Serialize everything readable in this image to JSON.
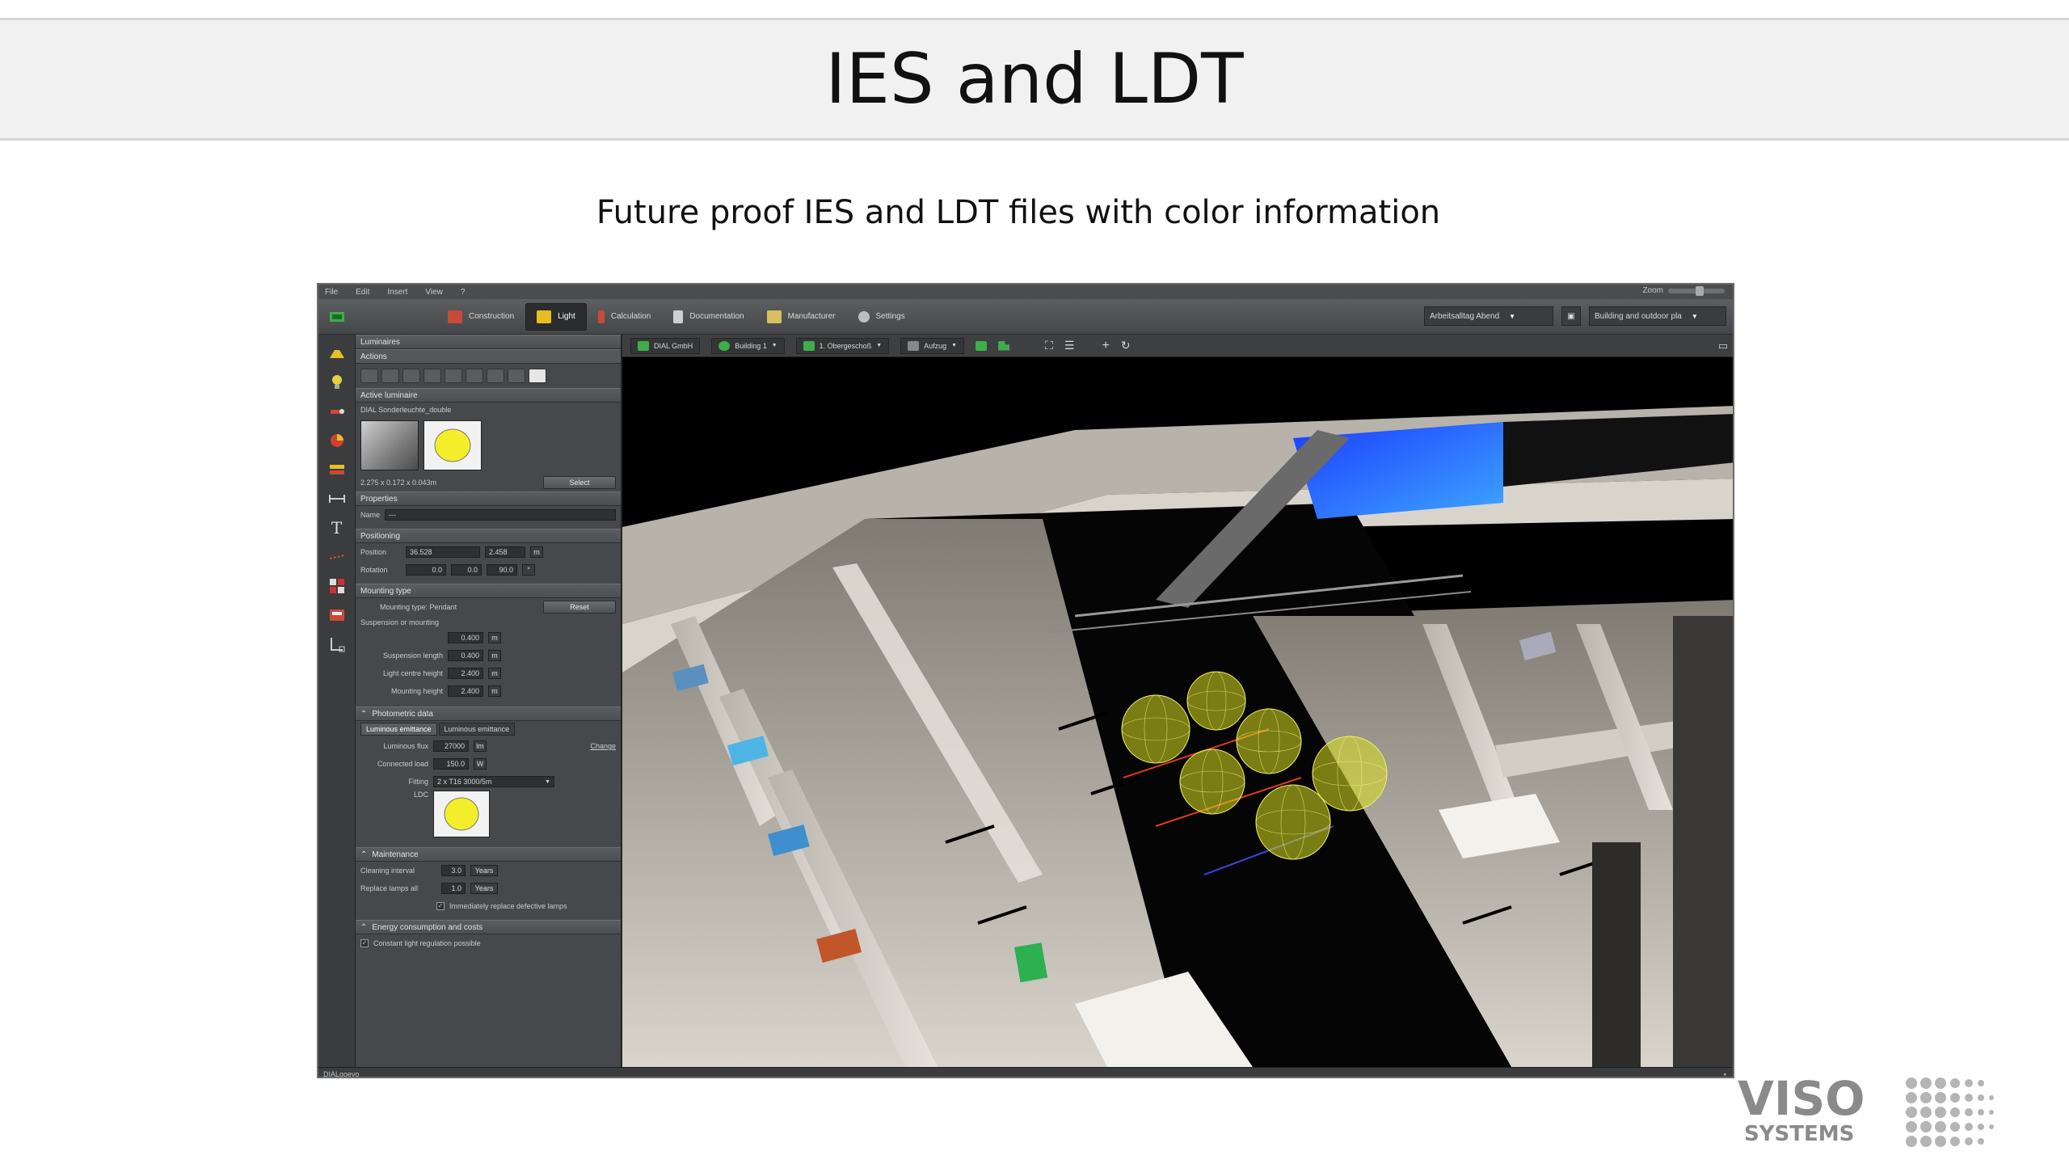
{
  "slide": {
    "title": "IES and LDT",
    "subtitle": "Future proof IES and LDT files with color information"
  },
  "logo": {
    "line1": "VISO",
    "line2": "SYSTEMS"
  },
  "app": {
    "menu": [
      "File",
      "Edit",
      "Insert",
      "View",
      "?"
    ],
    "zoom_label": "Zoom",
    "toolbar_tabs": [
      {
        "label": "Construction",
        "icon": "construction-icon",
        "color": "#c94a3a",
        "active": false
      },
      {
        "label": "Light",
        "icon": "light-icon",
        "color": "#e6c020",
        "active": true
      },
      {
        "label": "Calculation",
        "icon": "calculation-icon",
        "color": "#c94a3a",
        "active": false
      },
      {
        "label": "Documentation",
        "icon": "documentation-icon",
        "color": "#cfcfcf",
        "active": false
      },
      {
        "label": "Manufacturer",
        "icon": "manufacturer-icon",
        "color": "#d8c060",
        "active": false
      },
      {
        "label": "Settings",
        "icon": "settings-icon",
        "color": "#bdbdbd",
        "active": false
      }
    ],
    "scene_select": "Arbeitsalltag Abend",
    "building_select": "Building and outdoor pla",
    "view_toolbar": {
      "company": "DIAL GmbH",
      "building": "Building 1",
      "floor": "1. Obergeschoß",
      "room": "Aufzug"
    },
    "panel": {
      "header": "Luminaires",
      "actions_header": "Actions",
      "active_header": "Active luminaire",
      "luminaire_name": "DIAL Sonderleuchte_double",
      "dimensions": "2.275 x 0.172 x 0.043m",
      "select_button": "Select",
      "properties_header": "Properties",
      "name_label": "Name",
      "name_value": "---",
      "positioning_header": "Positioning",
      "position_label": "Position",
      "position_x": "36.528",
      "position_y": "2.458",
      "position_unit": "m",
      "rotation_label": "Rotation",
      "rot_x": "0.0",
      "rot_y": "0.0",
      "rot_z": "90.0",
      "rot_unit": "°",
      "mounting_header": "Mounting type",
      "mounting_type_label": "Mounting type: Pendant",
      "reset_button": "Reset",
      "suspension_label": "Suspension or mounting",
      "suspension_value": "0.400",
      "susp_len_label": "Suspension length",
      "susp_len_value": "0.400",
      "light_centre_label": "Light centre height",
      "light_centre_value": "2.400",
      "mount_height_label": "Mounting height",
      "mount_height_value": "2.400",
      "unit_m": "m",
      "photometric_header": "Photometric data",
      "tab_a": "Luminous emittance",
      "tab_b": "Luminous emittance",
      "flux_label": "Luminous flux",
      "flux_value": "27000",
      "flux_unit": "lm",
      "load_label": "Connected load",
      "load_value": "150.0",
      "load_unit": "W",
      "change_link": "Change",
      "fitting_label": "Fitting",
      "fitting_value": "2 x T16 3000/5m",
      "ldc_label": "LDC",
      "maintenance_header": "Maintenance",
      "cleaning_label": "Cleaning interval",
      "cleaning_value": "3.0",
      "cleaning_unit": "Years",
      "replace_label": "Replace lamps all",
      "replace_value": "1.0",
      "replace_unit": "Years",
      "immediate_label": "Immediately replace defective lamps",
      "energy_header": "Energy consumption and costs",
      "constant_label": "Constant light regulation possible"
    },
    "status": "DIALgoevo"
  }
}
